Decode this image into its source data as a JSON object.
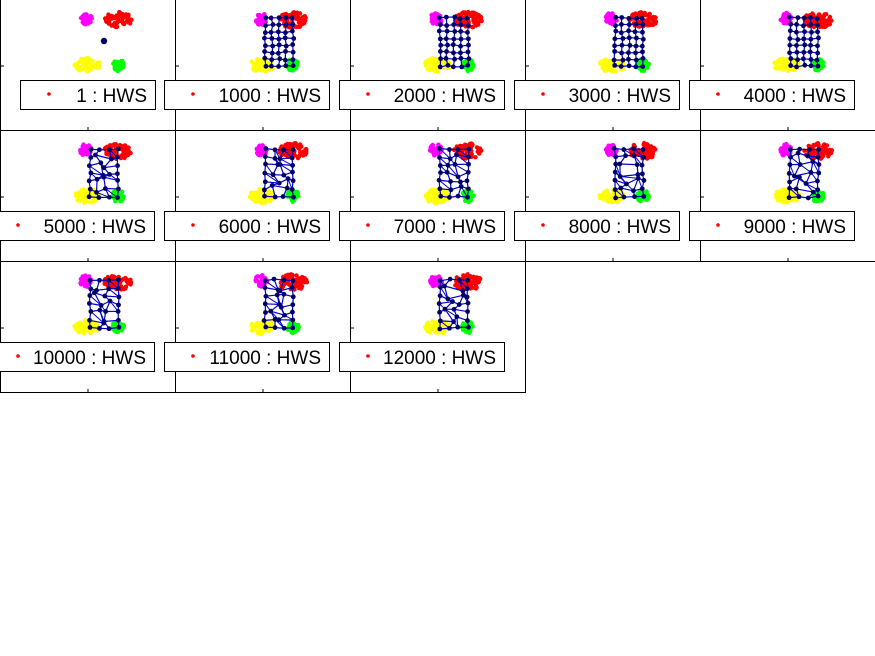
{
  "figure": {
    "panel_count": 13,
    "colors": {
      "magenta": "#ff00ff",
      "red": "#ff0000",
      "yellow": "#ffff00",
      "green": "#00ff00",
      "network": "#0000cc",
      "node": "#000066",
      "legend_marker": "#ff0000",
      "axes": "#000000"
    }
  },
  "chart_data": [
    {
      "type": "scatter",
      "legend": "1 : HWS",
      "iteration": 1,
      "network_state": "collapsed"
    },
    {
      "type": "scatter",
      "legend": "1000 : HWS",
      "iteration": 1000,
      "network_state": "grid"
    },
    {
      "type": "scatter",
      "legend": "2000 : HWS",
      "iteration": 2000,
      "network_state": "grid"
    },
    {
      "type": "scatter",
      "legend": "3000 : HWS",
      "iteration": 3000,
      "network_state": "grid"
    },
    {
      "type": "scatter",
      "legend": "4000 : HWS",
      "iteration": 4000,
      "network_state": "grid"
    },
    {
      "type": "scatter",
      "legend": "5000 : HWS",
      "iteration": 5000,
      "network_state": "frame"
    },
    {
      "type": "scatter",
      "legend": "6000 : HWS",
      "iteration": 6000,
      "network_state": "frame"
    },
    {
      "type": "scatter",
      "legend": "7000 : HWS",
      "iteration": 7000,
      "network_state": "frame"
    },
    {
      "type": "scatter",
      "legend": "8000 : HWS",
      "iteration": 8000,
      "network_state": "frame"
    },
    {
      "type": "scatter",
      "legend": "9000 : HWS",
      "iteration": 9000,
      "network_state": "frame"
    },
    {
      "type": "scatter",
      "legend": "10000 : HWS",
      "iteration": 10000,
      "network_state": "frame"
    },
    {
      "type": "scatter",
      "legend": "11000 : HWS",
      "iteration": 11000,
      "network_state": "frame"
    },
    {
      "type": "scatter",
      "legend": "12000 : HWS",
      "iteration": 12000,
      "network_state": "frame"
    }
  ]
}
